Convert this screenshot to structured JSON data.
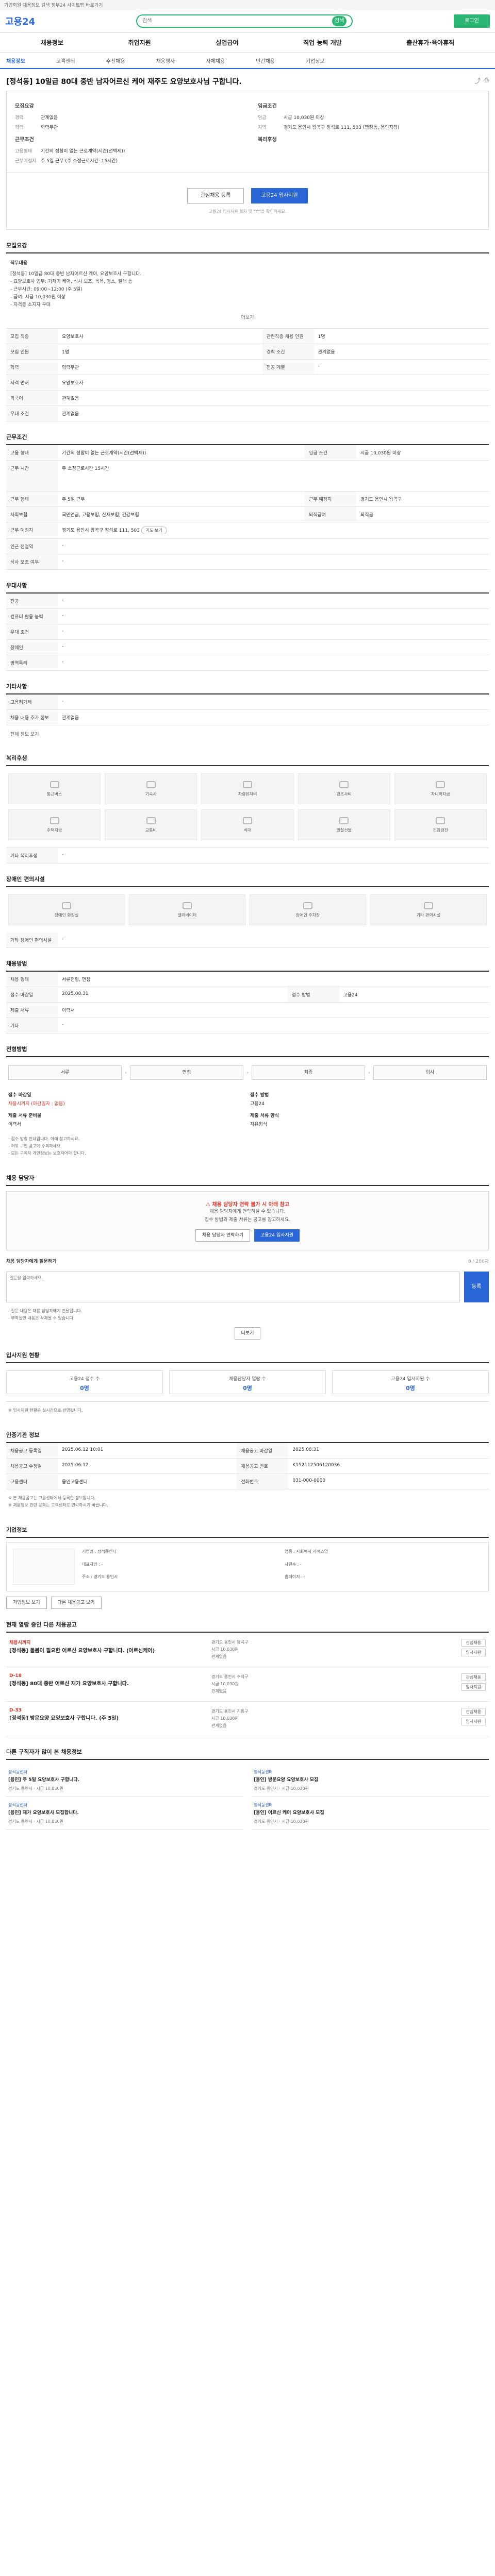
{
  "topbar": {
    "text": "기업회원 채용정보 검색 정부24 사이트맵 바로가기"
  },
  "header": {
    "logo": "고용24",
    "search_placeholder": "검색",
    "search_btn": "검색",
    "right_btn": "로그인"
  },
  "gnb": [
    "채용정보",
    "취업지원",
    "실업급여",
    "직업 능력 개발",
    "출산휴가·육아휴직"
  ],
  "lnb": [
    "채용정보",
    "고객센터",
    "추천채용",
    "채용행사",
    "자체채용",
    "민간채용",
    "기업정보"
  ],
  "job": {
    "title": "[정석동] 10일급 80대 중반 남자어르신 케어 재주도 요양보호사님 구합니다.",
    "company_label": "회사정보",
    "company_name": "정석동센터",
    "summary": {
      "left_title": "모집요강",
      "left": [
        {
          "k": "경력",
          "v": "관계없음"
        },
        {
          "k": "학력",
          "v": "학력무관"
        }
      ],
      "left2_title": "근무조건",
      "left2": [
        {
          "k": "고용형태",
          "v": "기간의 정함이 없는 근로계약(시간(선택제))"
        },
        {
          "k": "근무예정지",
          "v": "주 5일 근무 (주 소정근로시간: 15시간)"
        }
      ],
      "right_title": "임금조건",
      "right": [
        {
          "k": "임금",
          "v": "시급 10,030원 이상"
        },
        {
          "k": "지역",
          "v": "경기도 용인시 왕곡구 정석로 111, 503 (행정동, 용인지점)"
        }
      ],
      "right2_title": "복리후생"
    },
    "apply": {
      "interest": "관심채용 등록",
      "apply": "고용24 입사지원",
      "notice": "고용24 입사지원 절차 및 방법을 확인하세요."
    }
  },
  "sections": {
    "recruit": {
      "title": "모집요강",
      "desc_title": "직무내용",
      "desc": [
        "[정석동] 10일급 80대 중반 남자어르신 케어, 요양보호사 구합니다.",
        "- 요양보호사 업무: 기저귀 케어, 식사 보조, 목욕, 청소, 빨래 등",
        "- 근무시간: 09:00~12:00 (주 5일)",
        "- 급여: 시급 10,030원 이상",
        "- 자격증 소지자 우대"
      ],
      "more": "더보기",
      "rows": [
        {
          "k": "모집 직종",
          "v": "요양보호사",
          "k2": "관련직종 채용 인원",
          "v2": "1명"
        },
        {
          "k": "모집 인원",
          "v": "1명",
          "k2": "경력 조건",
          "v2": "관계없음"
        },
        {
          "k": "학력",
          "v": "학력무관",
          "k2": "전공 계열",
          "v2": "-"
        },
        {
          "k": "자격 면허",
          "v": "요양보호사",
          "k2": "",
          "v2": ""
        },
        {
          "k": "외국어",
          "v": "관계없음",
          "k2": "",
          "v2": ""
        },
        {
          "k": "우대 조건",
          "v": "관계없음",
          "k2": "",
          "v2": ""
        }
      ]
    },
    "work": {
      "title": "근무조건",
      "rows": [
        {
          "k": "고용 형태",
          "v": "기간의 정함이 없는 근로계약(시간(선택제))",
          "k2": "임금 조건",
          "v2": "시급 10,030원 이상"
        },
        {
          "k": "근무 시간",
          "v": "주 소정근로시간 15시간",
          "k2": "",
          "v2": ""
        },
        {
          "k": "근무 형태",
          "v": "주 5일 근무",
          "k2": "근무 예정지",
          "v2": "경기도 용인시 왕곡구"
        },
        {
          "k": "사회보험",
          "v": "국민연금, 고용보험, 산재보험, 건강보험",
          "k2": "퇴직급여",
          "v2": "퇴직금"
        },
        {
          "k": "근무 예정지",
          "v": "경기도 용인시 왕곡구 정석로 111, 503",
          "k2": "",
          "v2": ""
        },
        {
          "k": "인근 전철역",
          "v": "-",
          "k2": "",
          "v2": ""
        },
        {
          "k": "식사 보조 여부",
          "v": "-",
          "k2": "",
          "v2": ""
        }
      ],
      "map_btn": "지도 보기"
    },
    "employer": {
      "title": "우대사항",
      "rows": [
        {
          "k": "전공",
          "v": "-"
        },
        {
          "k": "컴퓨터 활용 능력",
          "v": "-"
        },
        {
          "k": "우대 조건",
          "v": "-"
        },
        {
          "k": "장애인",
          "v": "-"
        },
        {
          "k": "병역특례",
          "v": "-"
        }
      ]
    },
    "etc": {
      "title": "기타사항",
      "rows": [
        {
          "k": "고용허가제",
          "v": "-"
        },
        {
          "k": "채용 내용 추가 정보",
          "v": "관계없음"
        }
      ],
      "more": "전체 정보 보기"
    },
    "benefit": {
      "title": "복리후생",
      "items": [
        "통근버스",
        "기숙사",
        "차량유지비",
        "경조사비",
        "자녀학자금"
      ],
      "items2": [
        "주택자금",
        "교통비",
        "식대",
        "명절선물",
        "건강검진"
      ],
      "etc_label": "기타 복리후생",
      "etc_value": "-"
    },
    "disabled": {
      "title": "장애인 편의시설",
      "items": [
        "장애인 화장실",
        "엘리베이터",
        "장애인 주차장",
        "기타 편의시설"
      ],
      "etc_label": "기타 장애인 편의시설",
      "etc_value": "-"
    },
    "apply_method": {
      "title": "채용방법",
      "rows": [
        {
          "k": "채용 형태",
          "v": "서류전형, 면접",
          "k2": "",
          "v2": ""
        },
        {
          "k": "접수 마감일",
          "v": "2025.08.31",
          "k2": "접수 방법",
          "v2": "고용24"
        },
        {
          "k": "제출 서류",
          "v": "이력서",
          "k2": "",
          "v2": ""
        },
        {
          "k": "기타",
          "v": "-",
          "k2": "",
          "v2": ""
        }
      ]
    },
    "process": {
      "title": "전형방법",
      "steps": [
        "서류",
        "면접",
        "최종",
        "입사"
      ],
      "deadline_label": "접수 마감일",
      "deadline": "채용시까지 (마감일자 : 없음)",
      "method_label": "접수 방법",
      "method": "고용24",
      "doc_label": "제출 서류 준비물",
      "doc": "이력서",
      "doc2_label": "제출 서류 양식",
      "doc2": "자유형식",
      "notes": [
        "- 접수 방법 안내입니다. 아래 참고하세요.",
        "- 허위 구인 광고에 주의하세요.",
        "- 모든 구직자 개인정보는 보호되어야 합니다."
      ]
    },
    "inquiry": {
      "title": "채용 담당자",
      "warn": "채용 담당자 연락 불가 시 아래 참고",
      "p1": "채용 담당자에게 연락하실 수 있습니다.",
      "p2": "접수 방법과 제출 서류는 공고를 참고하세요.",
      "btn1": "채용 담당자 연락하기",
      "btn2": "고용24 입사지원",
      "review_title": "채용 담당자에게 질문하기",
      "review_placeholder": "질문을 입력하세요.",
      "review_submit": "등록",
      "review_hint": "0 / 200자",
      "notes": [
        "- 질문 내용은 채용 담당자에게 전달됩니다.",
        "- 부적절한 내용은 삭제될 수 있습니다."
      ],
      "more_btn": "더보기"
    },
    "stats": {
      "title": "입사지원 현황",
      "items": [
        {
          "label": "고용24 접수 수",
          "value": "0명"
        },
        {
          "label": "채용담당자 열람 수",
          "value": "0명"
        },
        {
          "label": "고용24 입사지원 수",
          "value": "0명"
        }
      ],
      "note": "※ 입사지원 현황은 실시간으로 반영됩니다."
    },
    "info": {
      "title": "인증기관 정보",
      "rows": [
        {
          "k": "채용공고 등록일",
          "v": "2025.06.12 10:01",
          "k2": "채용공고 마감일",
          "v2": "2025.08.31"
        },
        {
          "k": "채용공고 수정일",
          "v": "2025.06.12",
          "k2": "채용공고 번호",
          "v2": "K152112506120036"
        },
        {
          "k": "고용센터",
          "v": "용인고용센터",
          "k2": "전화번호",
          "v2": "031-000-0000"
        }
      ],
      "notes": [
        "※ 본 채용공고는 고용센터에서 등록한 정보입니다.",
        "※ 채용정보 관련 문의는 고객센터로 연락하시기 바랍니다."
      ]
    },
    "company": {
      "title": "기업정보",
      "fields": [
        {
          "k": "기업명",
          "v": "정석동센터"
        },
        {
          "k": "업종",
          "v": "사회복지 서비스업"
        },
        {
          "k": "대표자명",
          "v": "-"
        },
        {
          "k": "사원수",
          "v": "-"
        },
        {
          "k": "주소",
          "v": "경기도 용인시"
        },
        {
          "k": "홈페이지",
          "v": "-"
        }
      ],
      "btn1": "기업정보 보기",
      "btn2": "다른 채용공고 보기"
    },
    "related": {
      "title": "현재 열람 중인 다른 채용공고",
      "jobs": [
        {
          "dday": "채용시까지",
          "title": "[정석동] 돌봄이 필요한 어르신 요양보호사 구합니다. (어르신케어)",
          "meta1": "경기도 용인시 왕곡구",
          "meta2": "시급 10,030원",
          "meta3": "관계없음",
          "b1": "관심채용",
          "b2": "입사지원"
        },
        {
          "dday": "D-18",
          "title": "[정석동] 80대 중반 어르신 재가 요양보호사 구합니다.",
          "meta1": "경기도 용인시 수지구",
          "meta2": "시급 10,030원",
          "meta3": "관계없음",
          "b1": "관심채용",
          "b2": "입사지원"
        },
        {
          "dday": "D-33",
          "title": "[정석동] 방문요양 요양보호사 구합니다. (주 5일)",
          "meta1": "경기도 용인시 기흥구",
          "meta2": "시급 10,030원",
          "meta3": "관계없음",
          "b1": "관심채용",
          "b2": "입사지원"
        }
      ]
    },
    "recommend": {
      "title": "다른 구직자가 많이 본 채용정보",
      "items": [
        {
          "org": "정석동센터",
          "title": "[용인] 주 5일 요양보호사 구합니다.",
          "meta": "경기도 용인시 · 시급 10,030원"
        },
        {
          "org": "정석동센터",
          "title": "[용인] 방문요양 요양보호사 모집",
          "meta": "경기도 용인시 · 시급 10,030원"
        },
        {
          "org": "정석동센터",
          "title": "[용인] 재가 요양보호사 모집합니다.",
          "meta": "경기도 용인시 · 시급 10,030원"
        },
        {
          "org": "정석동센터",
          "title": "[용인] 어르신 케어 요양보호사 모집",
          "meta": "경기도 용인시 · 시급 10,030원"
        }
      ]
    }
  }
}
